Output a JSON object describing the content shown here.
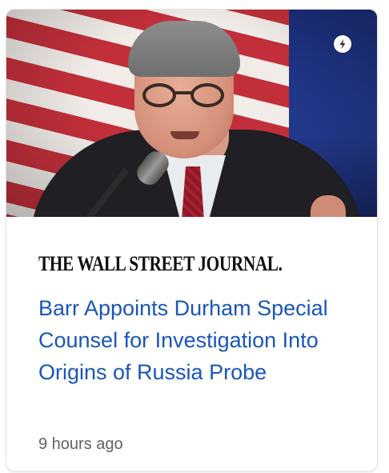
{
  "card": {
    "publisher": "THE WALL STREET JOURNAL.",
    "headline": "Barr Appoints Durham Special Counsel for Investigation Into Origins of Russia Probe",
    "timestamp": "9 hours ago",
    "badge_icon": "amp-lightning-icon",
    "headline_color": "#1a56b8"
  }
}
